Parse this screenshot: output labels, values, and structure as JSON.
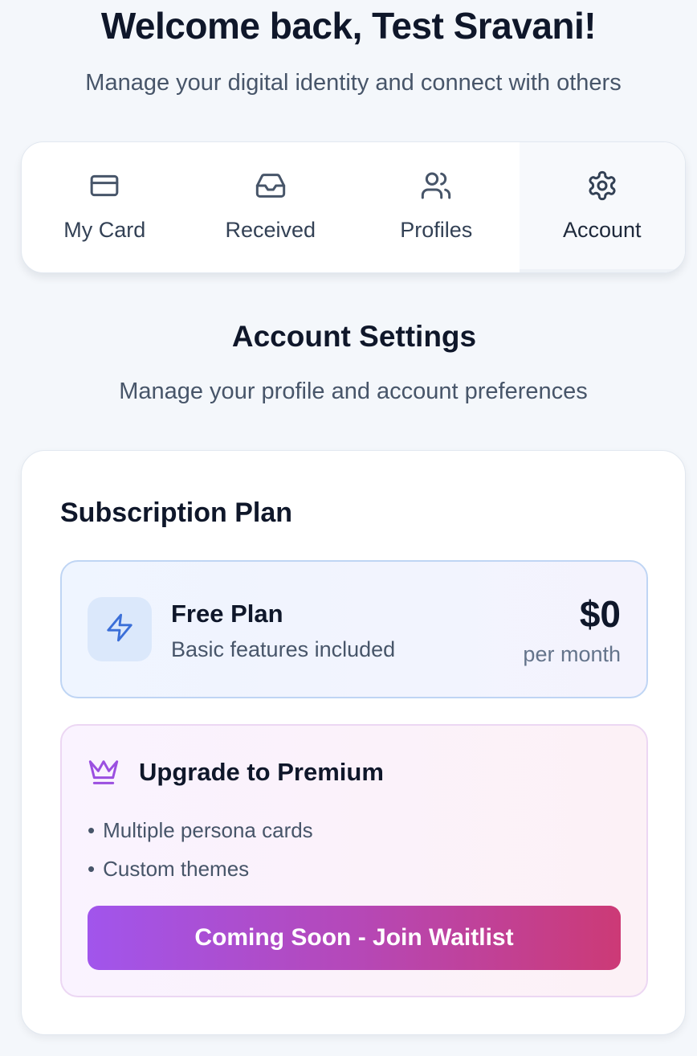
{
  "header": {
    "title": "Welcome back, Test Sravani!",
    "subtitle": "Manage your digital identity and connect with others"
  },
  "tabs": [
    {
      "label": "My Card",
      "icon": "credit-card-icon",
      "active": false
    },
    {
      "label": "Received",
      "icon": "inbox-icon",
      "active": false
    },
    {
      "label": "Profiles",
      "icon": "users-icon",
      "active": false
    },
    {
      "label": "Account",
      "icon": "gear-icon",
      "active": true
    }
  ],
  "account": {
    "title": "Account Settings",
    "subtitle": "Manage your profile and account preferences"
  },
  "subscription": {
    "title": "Subscription Plan",
    "plan": {
      "icon": "lightning-icon",
      "name": "Free Plan",
      "description": "Basic features included",
      "price": "$0",
      "period": "per month"
    },
    "premium": {
      "icon": "crown-icon",
      "title": "Upgrade to Premium",
      "features": [
        "Multiple persona cards",
        "Custom themes"
      ],
      "button_label": "Coming Soon - Join Waitlist"
    }
  },
  "colors": {
    "background": "#f4f7fb",
    "text_primary": "#0f172a",
    "text_secondary": "#475569",
    "plan_accent": "#3b6fd8",
    "premium_accent": "#9b4fe0",
    "button_gradient_start": "#a155ec",
    "button_gradient_end": "#cc3a76"
  }
}
